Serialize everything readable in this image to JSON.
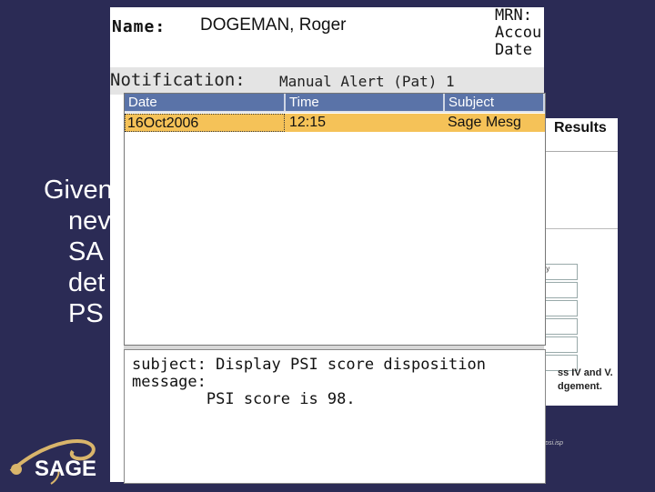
{
  "slide": {
    "text_lines": [
      "Given",
      "nev",
      "SA",
      "det",
      "PS"
    ]
  },
  "results_panel": {
    "title": "Results",
    "field_label": "ty",
    "note_lines": [
      "ss IV and V.",
      "dgement."
    ],
    "footer": "rapsi.isp"
  },
  "patient": {
    "name_label": "Name:",
    "name": "DOGEMAN, Roger",
    "mrn_label": "MRN:",
    "account_label": "Accou",
    "date_label": "Date"
  },
  "notification": {
    "label": "Notification:",
    "value": "Manual Alert (Pat) 1"
  },
  "alert_list": {
    "columns": [
      "Date",
      "Time",
      "Subject"
    ],
    "rows": [
      {
        "date": "16Oct2006",
        "time": "12:15",
        "subject": "Sage Mesg"
      }
    ],
    "selected_row_color": "#f5c258",
    "header_color": "#5a73a8"
  },
  "message": {
    "line1": "subject: Display PSI score disposition",
    "line2": "message:",
    "line3": "        PSI score is 98."
  },
  "logo": {
    "text": "SAGE"
  }
}
